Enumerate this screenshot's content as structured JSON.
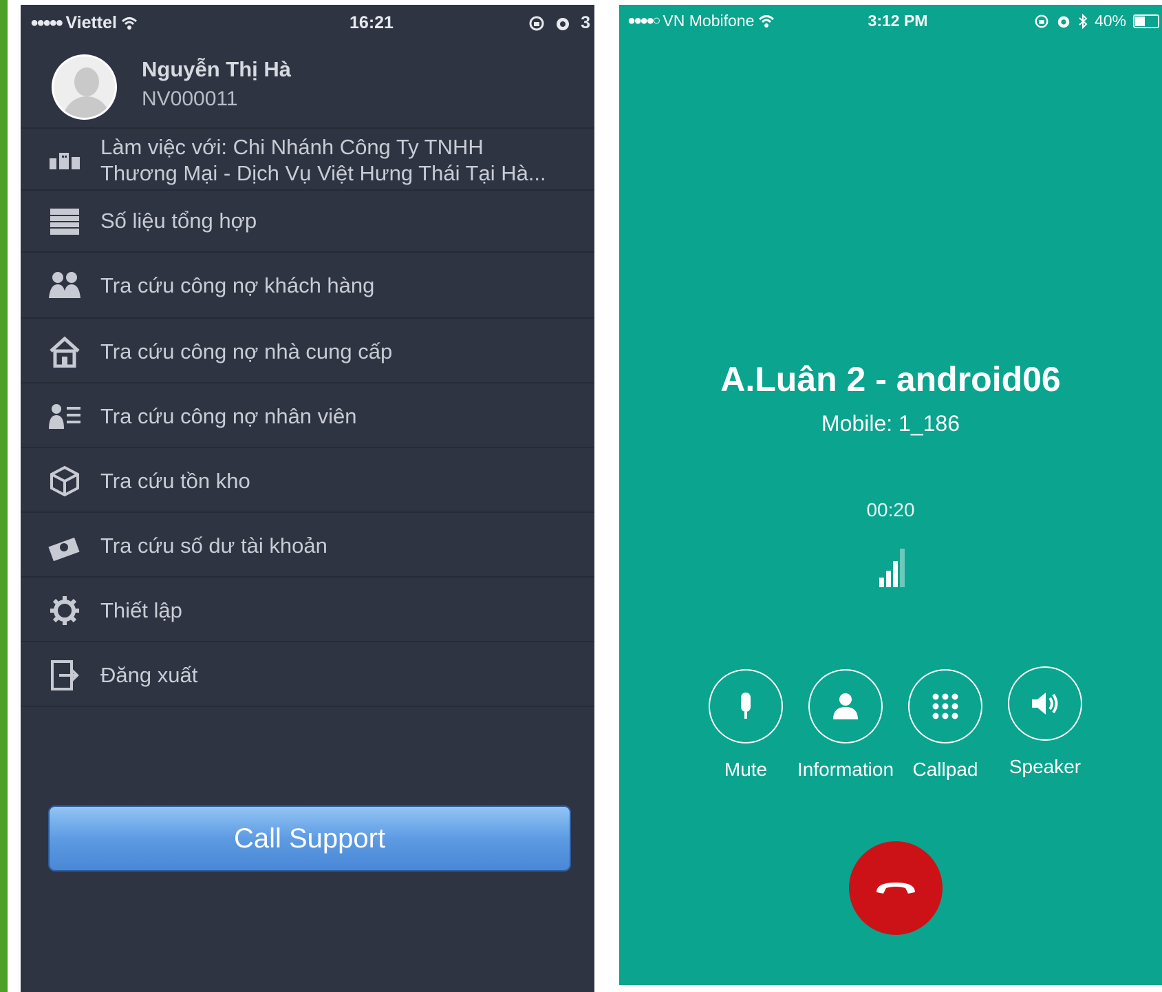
{
  "left_phone": {
    "status_bar": {
      "carrier": "Viettel",
      "time": "16:21",
      "battery_partial": "3"
    },
    "profile": {
      "name": "Nguyễn Thị Hà",
      "code": "NV000011"
    },
    "company": {
      "line1": "Làm việc với: Chi Nhánh Công Ty TNHH",
      "line2": "Thương Mại - Dịch Vụ Việt Hưng Thái Tại Hà..."
    },
    "menu": [
      {
        "label": "Số liệu tổng hợp",
        "icon": "report-icon"
      },
      {
        "label": "Tra cứu công nợ khách hàng",
        "icon": "customers-icon"
      },
      {
        "label": "Tra cứu công nợ nhà cung cấp",
        "icon": "home-icon"
      },
      {
        "label": "Tra cứu công nợ nhân viên",
        "icon": "employee-list-icon"
      },
      {
        "label": "Tra cứu tồn kho",
        "icon": "box-icon"
      },
      {
        "label": "Tra cứu số dư tài khoản",
        "icon": "money-icon"
      },
      {
        "label": "Thiết lập",
        "icon": "gear-icon"
      },
      {
        "label": "Đăng xuất",
        "icon": "logout-icon"
      }
    ],
    "call_support_label": "Call Support"
  },
  "right_phone": {
    "status_bar": {
      "carrier": "VN Mobifone",
      "time": "3:12 PM",
      "battery": "40%"
    },
    "caller_name": "A.Luân 2 - android06",
    "caller_number": "Mobile: 1_186",
    "duration": "00:20",
    "controls": [
      {
        "label": "Mute",
        "icon": "microphone-icon"
      },
      {
        "label": "Information",
        "icon": "user-icon"
      },
      {
        "label": "Callpad",
        "icon": "keypad-icon"
      },
      {
        "label": "Speaker",
        "icon": "speaker-icon"
      }
    ],
    "colors": {
      "background": "#0aa48f",
      "hangup": "#cc1216"
    }
  },
  "colors": {
    "left_background": "#2e3442",
    "accent_green": "#4ea026",
    "support_button": "#5d9be3"
  }
}
